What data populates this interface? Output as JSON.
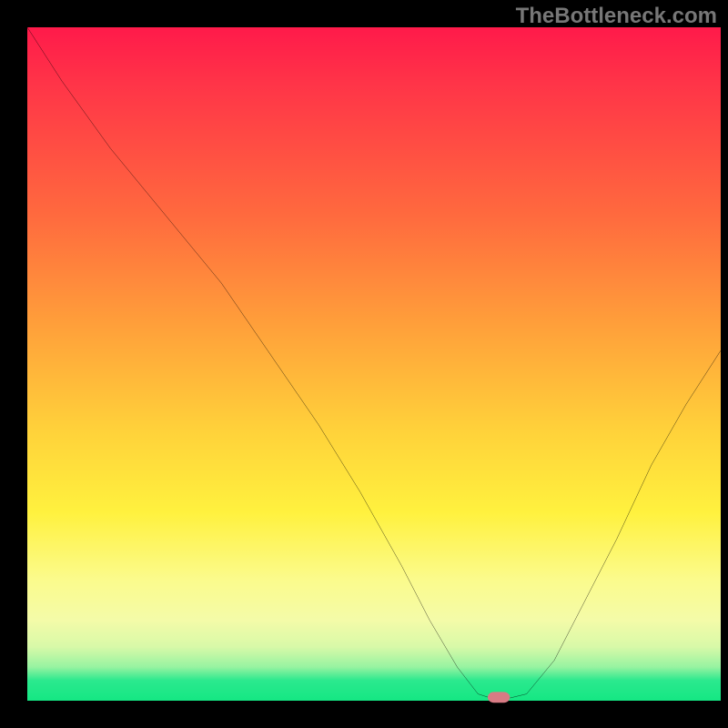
{
  "watermark": "TheBottleneck.com",
  "chart_data": {
    "type": "line",
    "title": "",
    "xlabel": "",
    "ylabel": "",
    "xlim": [
      0,
      100
    ],
    "ylim": [
      0,
      100
    ],
    "x": [
      0,
      5,
      12,
      20,
      28,
      36,
      42,
      48,
      54,
      58,
      62,
      65,
      68,
      72,
      76,
      80,
      85,
      90,
      95,
      100
    ],
    "values": [
      100,
      92,
      82,
      72,
      62,
      50,
      41,
      31,
      20,
      12,
      5,
      1,
      0,
      1,
      6,
      14,
      24,
      35,
      44,
      52
    ],
    "marker_point": {
      "x": 68,
      "y": 0
    },
    "gradient_stops": [
      {
        "pos": 0,
        "color": "#ff1a4a"
      },
      {
        "pos": 28,
        "color": "#ff6a3e"
      },
      {
        "pos": 60,
        "color": "#ffd23a"
      },
      {
        "pos": 82,
        "color": "#fbfb8c"
      },
      {
        "pos": 95,
        "color": "#97f3a1"
      },
      {
        "pos": 100,
        "color": "#15e783"
      }
    ]
  }
}
